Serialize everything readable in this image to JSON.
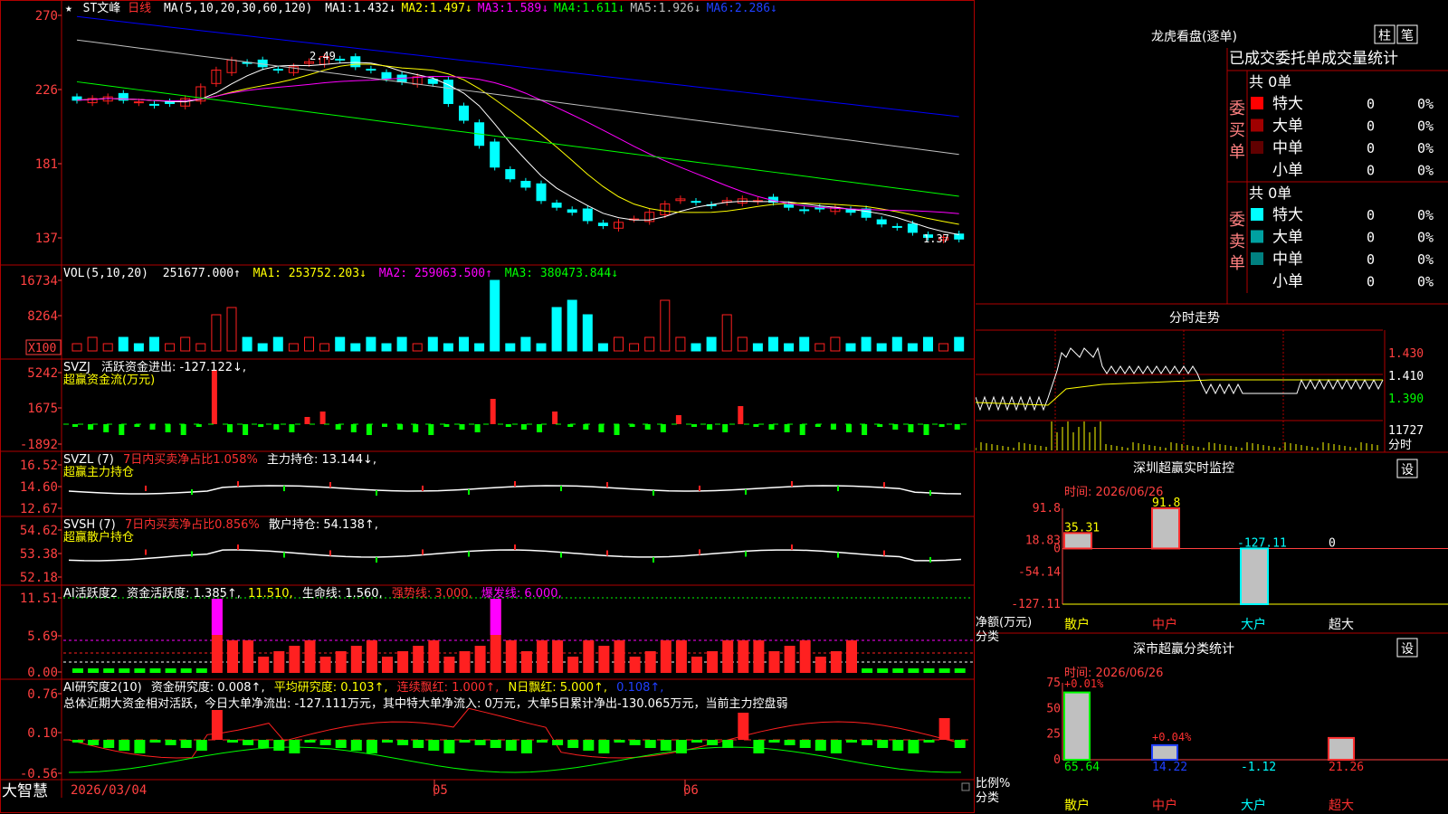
{
  "colors": {
    "up": "#ff2020",
    "down": "#00ffff",
    "grid": "#b00000",
    "axis_text": "#ff4040",
    "ma1": "#ffffff",
    "ma2": "#ffff00",
    "ma3": "#ff00ff",
    "ma4": "#00ff00",
    "ma5": "#c0c0c0",
    "ma6": "#0000ff",
    "green": "#00ff00",
    "magenta": "#ff00ff"
  },
  "header": {
    "star": "★",
    "name": "ST文峰",
    "period": "日线",
    "ma_label": "MA(5,10,20,30,60,120)",
    "mas": [
      {
        "label": "MA1:",
        "value": "1.432↓",
        "color": "#ffffff"
      },
      {
        "label": "MA2:",
        "value": "1.497↓",
        "color": "#ffff00"
      },
      {
        "label": "MA3:",
        "value": "1.589↓",
        "color": "#ff00ff"
      },
      {
        "label": "MA4:",
        "value": "1.611↓",
        "color": "#00ff00"
      },
      {
        "label": "MA5:",
        "value": "1.926↓",
        "color": "#c0c0c0"
      },
      {
        "label": "MA6:",
        "value": "2.286↓",
        "color": "#2040ff"
      }
    ]
  },
  "main_panel": {
    "y_ticks": [
      "270",
      "226",
      "181",
      "137"
    ],
    "high_label": "2.49",
    "low_label": "1.37"
  },
  "vol_panel": {
    "label": "VOL(5,10,20)",
    "value": "251677.000↑",
    "ma1": "MA1: 253752.203↓",
    "ma2": "MA2: 259063.500↑",
    "ma3": "MA3: 380473.844↓",
    "y_ticks": [
      "16734",
      "8264"
    ],
    "unit": "X100"
  },
  "svzj_panel": {
    "label": "SVZJ",
    "text": "活跃资金进出: -127.122↓,",
    "sub": "超赢资金流(万元)",
    "y_ticks": [
      "5242",
      "1675",
      "-1892"
    ]
  },
  "svzl_panel": {
    "label": "SVZL (7)",
    "text1": "7日内买卖净占比1.058%",
    "text2": "主力持仓: 13.144↓,",
    "sub": "超赢主力持仓",
    "y_ticks": [
      "16.52",
      "14.60",
      "12.67"
    ]
  },
  "svsh_panel": {
    "label": "SVSH (7)",
    "text1": "7日内买卖净占比0.856%",
    "text2": "散户持仓: 54.138↑,",
    "sub": "超赢散户持仓",
    "y_ticks": [
      "54.62",
      "53.38",
      "52.18"
    ]
  },
  "ai_panel": {
    "label": "AI活跃度2",
    "t1": "资金活跃度: 1.385↑,",
    "t2": "11.510,",
    "t3": "生命线: 1.560,",
    "t4": "强势线: 3.000,",
    "t5": "爆发线: 6.000,",
    "y_ticks": [
      "11.51",
      "5.69",
      "0.00"
    ]
  },
  "research_panel": {
    "label": "AI研究度2(10)",
    "t1": "资金研究度: 0.008↑,",
    "t2": "平均研究度: 0.103↑,",
    "t3": "连续飘红: 1.000↑,",
    "t4": "N日飘红: 5.000↑,",
    "t5": "0.108↑,",
    "summary": "总体近期大资金相对活跃，今日大单净流出: -127.111万元，其中特大单净流入: 0万元，大单5日累计净出-130.065万元，当前主力控盘弱",
    "y_ticks": [
      "0.76",
      "0.10",
      "-0.56"
    ]
  },
  "bottom_bar": {
    "brand": "大智慧",
    "dates": [
      "2026/03/04",
      "05",
      "06"
    ]
  },
  "dragon": {
    "title": "龙虎看盘(逐单)",
    "btn1": "柱",
    "btn2": "笔",
    "tabs": "已成交委托单成交量统计",
    "buy": {
      "side": "委买单",
      "total": "共 0单",
      "rows": [
        {
          "name": "特大",
          "count": "0",
          "pct": "0%",
          "color": "#ff0000"
        },
        {
          "name": "大单",
          "count": "0",
          "pct": "0%",
          "color": "#a00000"
        },
        {
          "name": "中单",
          "count": "0",
          "pct": "0%",
          "color": "#600000"
        },
        {
          "name": "小单",
          "count": "0",
          "pct": "0%",
          "color": ""
        }
      ]
    },
    "sell": {
      "side": "委卖单",
      "total": "共 0单",
      "rows": [
        {
          "name": "特大",
          "count": "0",
          "pct": "0%",
          "color": "#00ffff"
        },
        {
          "name": "大单",
          "count": "0",
          "pct": "0%",
          "color": "#00a0a0"
        },
        {
          "name": "中单",
          "count": "0",
          "pct": "0%",
          "color": "#008080"
        },
        {
          "name": "小单",
          "count": "0",
          "pct": "0%",
          "color": ""
        }
      ]
    }
  },
  "intraday": {
    "title": "分时走势",
    "prices": [
      "1.430",
      "1.410",
      "1.390"
    ],
    "vol": "11727",
    "vol_label": "分时"
  },
  "monitor": {
    "title": "深圳超赢实时监控",
    "btn": "设",
    "date": "时间: 2026/06/26",
    "y_ticks": [
      "91.8",
      "18.83",
      "0",
      "-54.14",
      "-127.11"
    ],
    "unit": "净额(万元)",
    "cat_label": "分类"
  },
  "classify": {
    "title": "深市超赢分类统计",
    "btn": "设",
    "date": "时间: 2026/06/26",
    "y_ticks": [
      "75",
      "50",
      "25",
      "0"
    ],
    "unit": "比例%",
    "cat_label": "分类"
  },
  "chart_data": [
    {
      "type": "bar",
      "title": "深圳超赢实时监控",
      "categories": [
        "散户",
        "中户",
        "大户",
        "超大"
      ],
      "values": [
        35.31,
        91.8,
        -127.11,
        0
      ],
      "ylabel": "净额(万元)",
      "ylim": [
        -127.11,
        91.8
      ]
    },
    {
      "type": "bar",
      "title": "深市超赢分类统计",
      "categories": [
        "散户",
        "中户",
        "大户",
        "超大"
      ],
      "values": [
        65.64,
        14.22,
        -1.12,
        21.26
      ],
      "annotations": [
        "+0.01%",
        "+0.04%"
      ],
      "ylabel": "比例%",
      "ylim": [
        0,
        75
      ]
    }
  ]
}
